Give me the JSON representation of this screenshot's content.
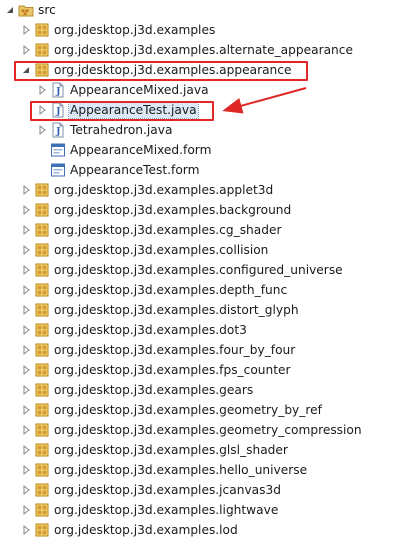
{
  "tree": {
    "root": {
      "label": "src",
      "icon": "source-folder-icon",
      "expanded": true
    },
    "packages": [
      {
        "label": "org.jdesktop.j3d.examples",
        "expanded": false
      },
      {
        "label": "org.jdesktop.j3d.examples.alternate_appearance",
        "expanded": false
      },
      {
        "label": "org.jdesktop.j3d.examples.appearance",
        "expanded": true,
        "highlighted": true,
        "children": [
          {
            "label": "AppearanceMixed.java",
            "type": "java",
            "has_twisty": true
          },
          {
            "label": "AppearanceTest.java",
            "type": "java",
            "has_twisty": true,
            "selected": true,
            "highlighted": true
          },
          {
            "label": "Tetrahedron.java",
            "type": "java",
            "has_twisty": true
          },
          {
            "label": "AppearanceMixed.form",
            "type": "form",
            "has_twisty": false
          },
          {
            "label": "AppearanceTest.form",
            "type": "form",
            "has_twisty": false
          }
        ]
      },
      {
        "label": "org.jdesktop.j3d.examples.applet3d",
        "expanded": false
      },
      {
        "label": "org.jdesktop.j3d.examples.background",
        "expanded": false
      },
      {
        "label": "org.jdesktop.j3d.examples.cg_shader",
        "expanded": false
      },
      {
        "label": "org.jdesktop.j3d.examples.collision",
        "expanded": false
      },
      {
        "label": "org.jdesktop.j3d.examples.configured_universe",
        "expanded": false
      },
      {
        "label": "org.jdesktop.j3d.examples.depth_func",
        "expanded": false
      },
      {
        "label": "org.jdesktop.j3d.examples.distort_glyph",
        "expanded": false
      },
      {
        "label": "org.jdesktop.j3d.examples.dot3",
        "expanded": false
      },
      {
        "label": "org.jdesktop.j3d.examples.four_by_four",
        "expanded": false
      },
      {
        "label": "org.jdesktop.j3d.examples.fps_counter",
        "expanded": false
      },
      {
        "label": "org.jdesktop.j3d.examples.gears",
        "expanded": false
      },
      {
        "label": "org.jdesktop.j3d.examples.geometry_by_ref",
        "expanded": false
      },
      {
        "label": "org.jdesktop.j3d.examples.geometry_compression",
        "expanded": false
      },
      {
        "label": "org.jdesktop.j3d.examples.glsl_shader",
        "expanded": false
      },
      {
        "label": "org.jdesktop.j3d.examples.hello_universe",
        "expanded": false
      },
      {
        "label": "org.jdesktop.j3d.examples.jcanvas3d",
        "expanded": false
      },
      {
        "label": "org.jdesktop.j3d.examples.lightwave",
        "expanded": false
      },
      {
        "label": "org.jdesktop.j3d.examples.lod",
        "expanded": false
      }
    ]
  },
  "colors": {
    "highlight_box": "#e02828",
    "selection_bg": "#dbe8f8",
    "package_icon": "#b8860b",
    "java_icon_letter": "#2f5fa8",
    "form_icon": "#3f6fb5"
  },
  "icons": {
    "package": "package-icon",
    "java": "java-file-icon",
    "form": "form-file-icon",
    "collapsed": "expand-arrow-icon",
    "expanded": "collapse-arrow-icon"
  }
}
